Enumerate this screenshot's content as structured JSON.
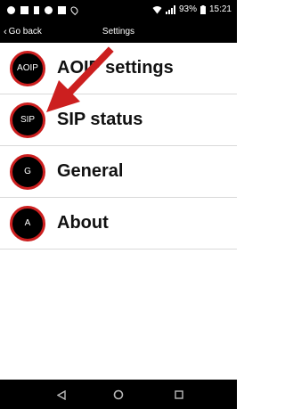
{
  "status_bar": {
    "battery_percent": "93%",
    "time": "15:21",
    "icons_left": [
      "notification-icon",
      "image-icon",
      "usb-icon",
      "notification-icon",
      "calendar-icon",
      "location-icon"
    ]
  },
  "action_bar": {
    "back_label": "Go back",
    "title": "Settings"
  },
  "menu": {
    "items": [
      {
        "badge": "AOIP",
        "label": "AOIP settings"
      },
      {
        "badge": "SIP",
        "label": "SIP status"
      },
      {
        "badge": "G",
        "label": "General"
      },
      {
        "badge": "A",
        "label": "About"
      }
    ]
  },
  "colors": {
    "accent": "#cc1f1f",
    "bar_background": "#000000"
  }
}
